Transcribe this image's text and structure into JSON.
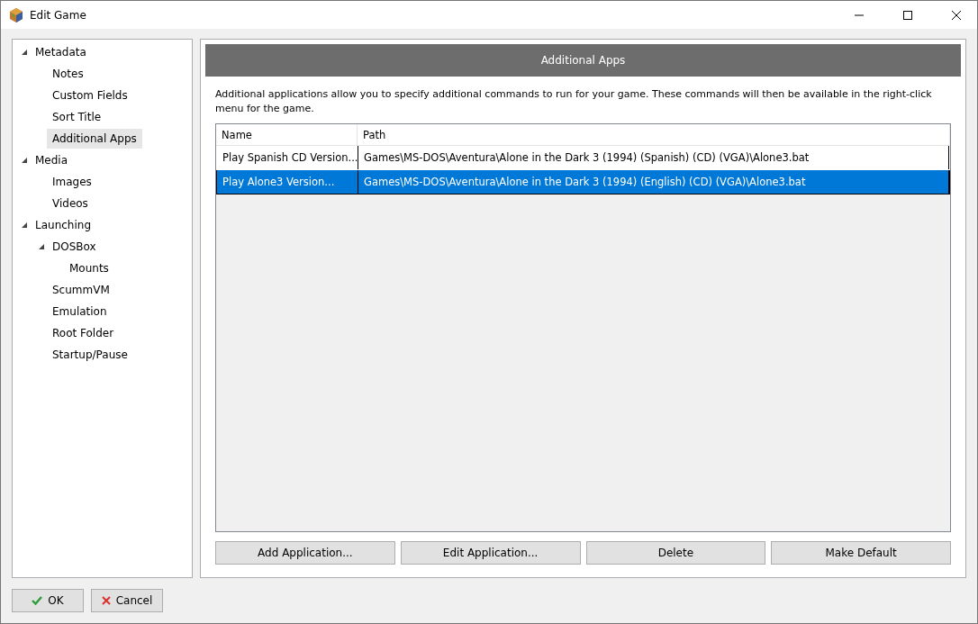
{
  "window": {
    "title": "Edit Game"
  },
  "tree": [
    {
      "label": "Metadata",
      "expanded": true,
      "selected": false,
      "children": [
        {
          "label": "Notes",
          "selected": false
        },
        {
          "label": "Custom Fields",
          "selected": false
        },
        {
          "label": "Sort Title",
          "selected": false
        },
        {
          "label": "Additional Apps",
          "selected": true
        }
      ]
    },
    {
      "label": "Media",
      "expanded": true,
      "selected": false,
      "children": [
        {
          "label": "Images",
          "selected": false
        },
        {
          "label": "Videos",
          "selected": false
        }
      ]
    },
    {
      "label": "Launching",
      "expanded": true,
      "selected": false,
      "children": [
        {
          "label": "DOSBox",
          "expanded": true,
          "selected": false,
          "children": [
            {
              "label": "Mounts",
              "selected": false
            }
          ]
        },
        {
          "label": "ScummVM",
          "selected": false
        },
        {
          "label": "Emulation",
          "selected": false
        },
        {
          "label": "Root Folder",
          "selected": false
        },
        {
          "label": "Startup/Pause",
          "selected": false
        }
      ]
    }
  ],
  "panel": {
    "header": "Additional Apps",
    "description": "Additional applications allow you to specify additional commands to run for your game.  These commands will then be available in the right-click menu for the game."
  },
  "table": {
    "columns": [
      "Name",
      "Path"
    ],
    "rows": [
      {
        "name": "Play Spanish CD Version...",
        "path": "Games\\MS-DOS\\Aventura\\Alone in the Dark 3 (1994) (Spanish) (CD) (VGA)\\Alone3.bat",
        "selected": false
      },
      {
        "name": "Play Alone3 Version...",
        "path": "Games\\MS-DOS\\Aventura\\Alone in the Dark 3 (1994) (English) (CD) (VGA)\\Alone3.bat",
        "selected": true
      }
    ]
  },
  "actions": [
    "Add Application...",
    "Edit Application...",
    "Delete",
    "Make Default"
  ],
  "footer": [
    {
      "label": "OK",
      "kind": "ok"
    },
    {
      "label": "Cancel",
      "kind": "cancel"
    }
  ]
}
